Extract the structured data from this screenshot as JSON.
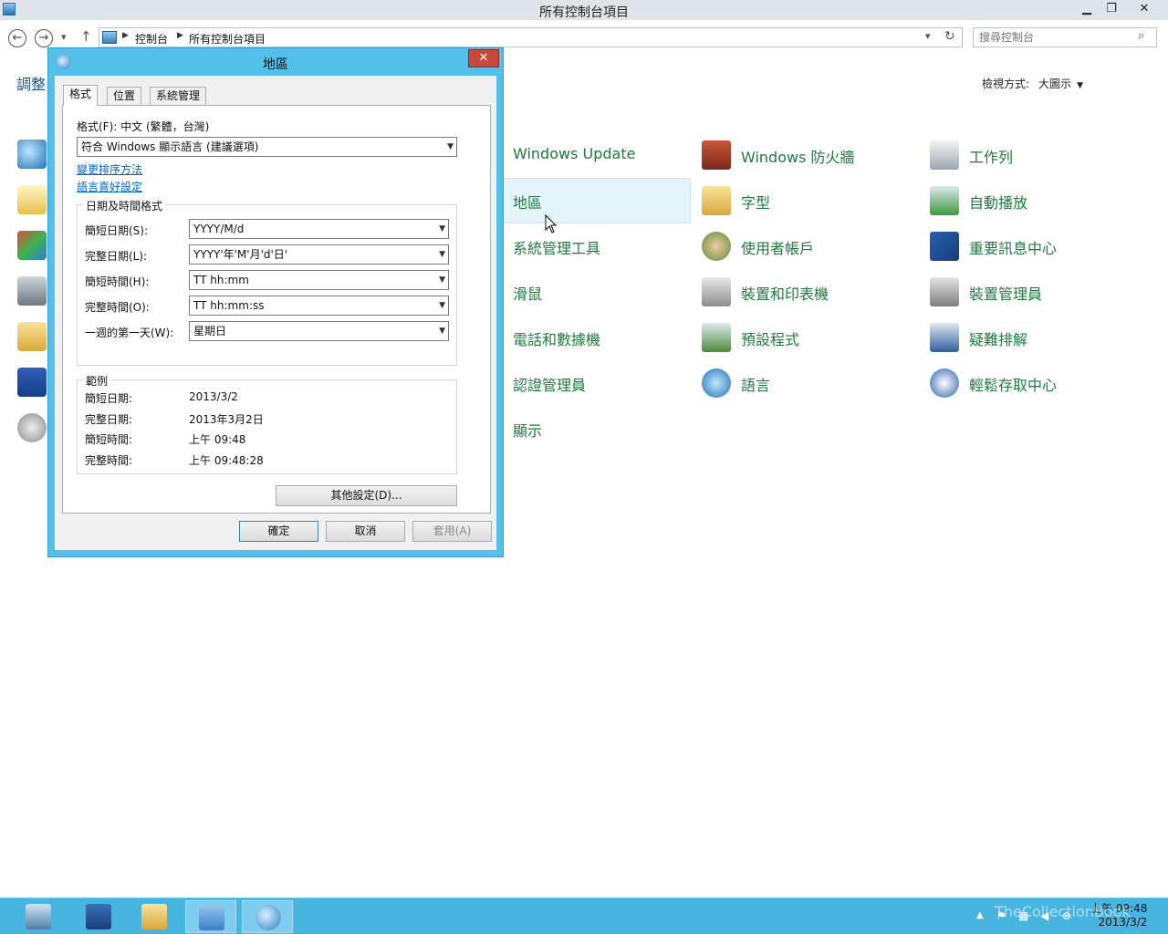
{
  "window": {
    "title": "所有控制台項目"
  },
  "nav": {
    "breadcrumb": [
      "控制台",
      "所有控制台項目"
    ],
    "search_placeholder": "搜尋控制台"
  },
  "left_heading": "調整",
  "view": {
    "label": "檢視方式:",
    "value": "大圖示"
  },
  "items_col1": [
    "Windows Update",
    "地區",
    "系統管理工具",
    "滑鼠",
    "電話和數據機",
    "認證管理員",
    "顯示"
  ],
  "items_col2": [
    "Windows 防火牆",
    "字型",
    "使用者帳戶",
    "裝置和印表機",
    "預設程式",
    "語言",
    "輕鬆存取中心"
  ],
  "items_col3": [
    "工作列",
    "自動播放",
    "重要訊息中心",
    "裝置管理員",
    "疑難排解"
  ],
  "dialog": {
    "title": "地區",
    "tabs": [
      "格式",
      "位置",
      "系統管理"
    ],
    "format_label": "格式(F): 中文 (繁體，台灣)",
    "format_value": "符合 Windows 顯示語言 (建議選項)",
    "link_sort": "變更排序方法",
    "link_lang": "語言喜好設定",
    "dt_group": "日期及時間格式",
    "fields": [
      {
        "label": "簡短日期(S):",
        "value": "YYYY/M/d"
      },
      {
        "label": "完整日期(L):",
        "value": "YYYY'年'M'月'd'日'"
      },
      {
        "label": "簡短時間(H):",
        "value": "TT hh:mm"
      },
      {
        "label": "完整時間(O):",
        "value": "TT hh:mm:ss"
      },
      {
        "label": "一週的第一天(W):",
        "value": "星期日"
      }
    ],
    "example_group": "範例",
    "examples": [
      {
        "label": "簡短日期:",
        "value": "2013/3/2"
      },
      {
        "label": "完整日期:",
        "value": "2013年3月2日"
      },
      {
        "label": "簡短時間:",
        "value": "上午 09:48"
      },
      {
        "label": "完整時間:",
        "value": "上午 09:48:28"
      }
    ],
    "more_btn": "其他設定(D)...",
    "ok": "確定",
    "cancel": "取消",
    "apply": "套用(A)"
  },
  "taskbar": {
    "time": "上午 09:48",
    "date": "2013/3/2"
  },
  "watermark": "TheCollectionBook",
  "colors": {
    "accent_green": "#1e7a3c",
    "dialog_frame": "#54bfe8",
    "taskbar": "#48b4e0"
  }
}
